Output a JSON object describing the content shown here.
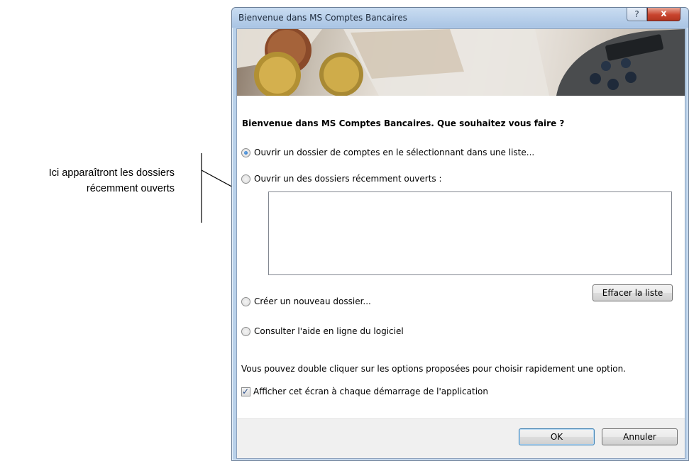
{
  "annotation": {
    "line1": "Ici apparaîtront les dossiers",
    "line2": "récemment ouverts"
  },
  "window": {
    "title": "Bienvenue dans MS Comptes Bancaires",
    "help_label": "?",
    "close_label": "x"
  },
  "dialog": {
    "heading": "Bienvenue dans MS Comptes Bancaires. Que souhaitez vous faire ?",
    "options": [
      {
        "label": "Ouvrir un dossier de comptes en le sélectionnant dans une liste...",
        "selected": true
      },
      {
        "label": "Ouvrir un des dossiers récemment ouverts :",
        "selected": false
      },
      {
        "label": "Créer un nouveau dossier...",
        "selected": false
      },
      {
        "label": "Consulter l'aide en ligne du logiciel",
        "selected": false
      }
    ],
    "recent_files": [],
    "clear_list_label": "Effacer la liste",
    "info": "Vous pouvez double cliquer sur les options proposées pour choisir rapidement une option.",
    "show_at_startup": {
      "label": "Afficher cet écran à chaque démarrage de l'application",
      "checked": true,
      "check_glyph": "✓"
    },
    "ok_label": "OK",
    "cancel_label": "Annuler"
  }
}
